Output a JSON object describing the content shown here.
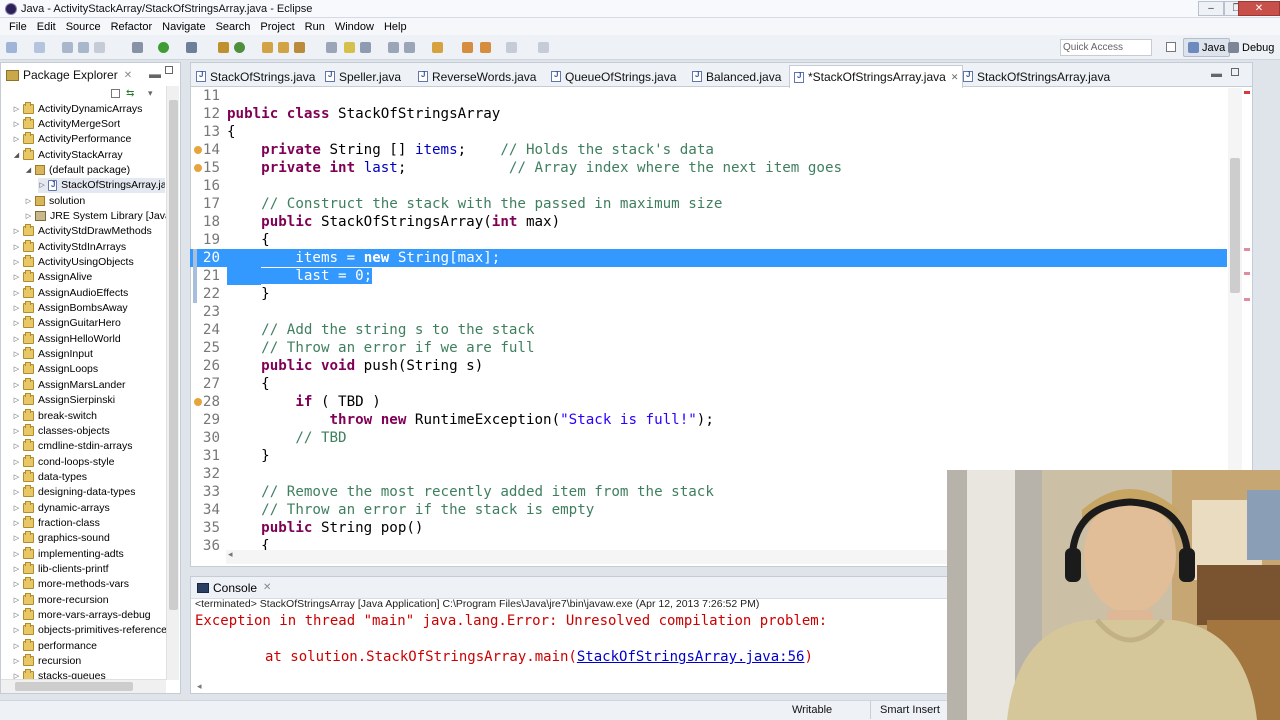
{
  "window": {
    "title": "Java - ActivityStackArray/StackOfStringsArray.java - Eclipse",
    "minimize": "–",
    "maximize": "❐",
    "close": "✕"
  },
  "menu": [
    "File",
    "Edit",
    "Source",
    "Refactor",
    "Navigate",
    "Search",
    "Project",
    "Run",
    "Window",
    "Help"
  ],
  "toolbar": {
    "quick_access_placeholder": "Quick Access",
    "perspectives": [
      {
        "label": "Java",
        "active": true
      },
      {
        "label": "Debug",
        "active": false
      }
    ]
  },
  "package_explorer": {
    "title": "Package Explorer",
    "items": [
      {
        "label": "ActivityDynamicArrays",
        "kind": "project",
        "twisty": "▷"
      },
      {
        "label": "ActivityMergeSort",
        "kind": "project",
        "twisty": "▷"
      },
      {
        "label": "ActivityPerformance",
        "kind": "project",
        "twisty": "▷"
      },
      {
        "label": "ActivityStackArray",
        "kind": "project",
        "twisty": "◢"
      },
      {
        "label": "(default package)",
        "kind": "package",
        "twisty": "◢"
      },
      {
        "label": "StackOfStringsArray.java",
        "kind": "java",
        "twisty": "▷"
      },
      {
        "label": "solution",
        "kind": "package",
        "twisty": "▷"
      },
      {
        "label": "JRE System Library [JavaSE",
        "kind": "library",
        "twisty": "▷"
      },
      {
        "label": "ActivityStdDrawMethods",
        "kind": "project",
        "twisty": "▷"
      },
      {
        "label": "ActivityStdInArrays",
        "kind": "project",
        "twisty": "▷"
      },
      {
        "label": "ActivityUsingObjects",
        "kind": "project",
        "twisty": "▷"
      },
      {
        "label": "AssignAlive",
        "kind": "project",
        "twisty": "▷"
      },
      {
        "label": "AssignAudioEffects",
        "kind": "project",
        "twisty": "▷"
      },
      {
        "label": "AssignBombsAway",
        "kind": "project",
        "twisty": "▷"
      },
      {
        "label": "AssignGuitarHero",
        "kind": "project",
        "twisty": "▷"
      },
      {
        "label": "AssignHelloWorld",
        "kind": "project",
        "twisty": "▷"
      },
      {
        "label": "AssignInput",
        "kind": "project",
        "twisty": "▷"
      },
      {
        "label": "AssignLoops",
        "kind": "project",
        "twisty": "▷"
      },
      {
        "label": "AssignMarsLander",
        "kind": "project",
        "twisty": "▷"
      },
      {
        "label": "AssignSierpinski",
        "kind": "project",
        "twisty": "▷"
      },
      {
        "label": "break-switch",
        "kind": "project",
        "twisty": "▷"
      },
      {
        "label": "classes-objects",
        "kind": "project",
        "twisty": "▷"
      },
      {
        "label": "cmdline-stdin-arrays",
        "kind": "project",
        "twisty": "▷"
      },
      {
        "label": "cond-loops-style",
        "kind": "project",
        "twisty": "▷"
      },
      {
        "label": "data-types",
        "kind": "project",
        "twisty": "▷"
      },
      {
        "label": "designing-data-types",
        "kind": "project",
        "twisty": "▷"
      },
      {
        "label": "dynamic-arrays",
        "kind": "project",
        "twisty": "▷"
      },
      {
        "label": "fraction-class",
        "kind": "project",
        "twisty": "▷"
      },
      {
        "label": "graphics-sound",
        "kind": "project",
        "twisty": "▷"
      },
      {
        "label": "implementing-adts",
        "kind": "project",
        "twisty": "▷"
      },
      {
        "label": "lib-clients-printf",
        "kind": "project",
        "twisty": "▷"
      },
      {
        "label": "more-methods-vars",
        "kind": "project",
        "twisty": "▷"
      },
      {
        "label": "more-recursion",
        "kind": "project",
        "twisty": "▷"
      },
      {
        "label": "more-vars-arrays-debug",
        "kind": "project",
        "twisty": "▷"
      },
      {
        "label": "objects-primitives-references",
        "kind": "project",
        "twisty": "▷"
      },
      {
        "label": "performance",
        "kind": "project",
        "twisty": "▷"
      },
      {
        "label": "recursion",
        "kind": "project",
        "twisty": "▷"
      },
      {
        "label": "stacks-queues",
        "kind": "project",
        "twisty": "▷"
      }
    ]
  },
  "editor": {
    "tabs": [
      {
        "label": "StackOfStrings.java",
        "active": false
      },
      {
        "label": "Speller.java",
        "active": false
      },
      {
        "label": "ReverseWords.java",
        "active": false
      },
      {
        "label": "QueueOfStrings.java",
        "active": false
      },
      {
        "label": "Balanced.java",
        "active": false
      },
      {
        "label": "*StackOfStringsArray.java",
        "active": true
      },
      {
        "label": "StackOfStringsArray.java",
        "active": false
      }
    ],
    "lines": [
      {
        "n": "11",
        "text": ""
      },
      {
        "n": "12",
        "text": ""
      },
      {
        "n": "13",
        "text": "{"
      },
      {
        "n": "14",
        "text": ""
      },
      {
        "n": "15",
        "text": ""
      },
      {
        "n": "16",
        "text": ""
      },
      {
        "n": "17",
        "text": "    // Construct the stack with the passed in maximum size"
      },
      {
        "n": "18",
        "text": ""
      },
      {
        "n": "19",
        "text": "    {"
      },
      {
        "n": "20",
        "text": ""
      },
      {
        "n": "21",
        "text": "        last = 0;"
      },
      {
        "n": "22",
        "text": "    }"
      },
      {
        "n": "23",
        "text": ""
      },
      {
        "n": "24",
        "text": "    // Add the string s to the stack"
      },
      {
        "n": "25",
        "text": "    // Throw an error if we are full"
      },
      {
        "n": "26",
        "text": ""
      },
      {
        "n": "27",
        "text": "    {"
      },
      {
        "n": "28",
        "text": ""
      },
      {
        "n": "29",
        "text": ""
      },
      {
        "n": "30",
        "text": "        // TBD"
      },
      {
        "n": "31",
        "text": "    }"
      },
      {
        "n": "32",
        "text": ""
      },
      {
        "n": "33",
        "text": "    // Remove the most recently added item from the stack"
      },
      {
        "n": "34",
        "text": "    // Throw an error if the stack is empty"
      },
      {
        "n": "35",
        "text": ""
      },
      {
        "n": "36",
        "text": "    {"
      }
    ],
    "tokens": {
      "l12_kw": "public class",
      "l12_name": " StackOfStringsArray",
      "l14_kw": "private",
      "l14_mid": " String [] ",
      "l14_field": "items",
      "l14_semi": ";    ",
      "l14_comment": "// Holds the stack's data",
      "l15_kw": "private int",
      "l15_mid": " ",
      "l15_field": "last",
      "l15_semi": ";            ",
      "l15_comment": "// Array index where the next item goes",
      "l18_kw": "public",
      "l18_rest": " StackOfStringsArray(",
      "l18_kw2": "int",
      "l18_end": " max)",
      "l20_field": "items",
      "l20_eq": " = ",
      "l20_kw": "new",
      "l20_rest": " String[max];",
      "l26_kw": "public void",
      "l26_rest": " push(String s)",
      "l28_kw": "if",
      "l28_rest": " ( TBD )",
      "l29_kw": "throw new",
      "l29_rest": " RuntimeException(",
      "l29_str": "\"Stack is full!\"",
      "l29_end": ");",
      "l35_kw": "public",
      "l35_rest": " String pop()"
    }
  },
  "console": {
    "title": "Console",
    "terminated": "<terminated> StackOfStringsArray [Java Application] C:\\Program Files\\Java\\jre7\\bin\\javaw.exe (Apr 12, 2013 7:26:52 PM)",
    "error_line1": "Exception in thread \"main\" java.lang.Error: Unresolved compilation problem:",
    "error_line2_prefix": "at solution.StackOfStringsArray.main(",
    "error_line2_link": "StackOfStringsArray.java:56",
    "error_line2_suffix": ")"
  },
  "status": {
    "writable": "Writable",
    "insert_mode": "Smart Insert"
  },
  "colors": {
    "selection": "#3399ff",
    "keyword": "#7f0055",
    "comment": "#3f7f5f",
    "string": "#2a00ff",
    "field": "#0000c0",
    "error": "#cc0000"
  }
}
